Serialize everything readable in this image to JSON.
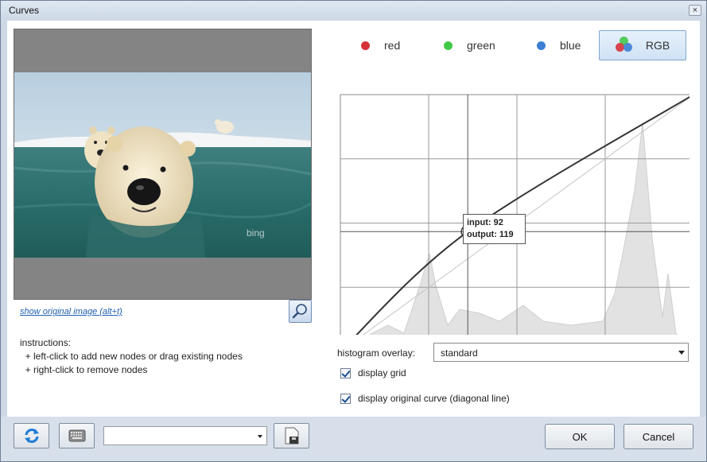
{
  "window": {
    "title": "Curves",
    "close_label": "×"
  },
  "preview": {
    "watermark": "bing"
  },
  "show_original_link": "show original image (alt+t)",
  "instructions": {
    "title": "instructions:",
    "lines": [
      "  + left-click to add new nodes or drag existing nodes",
      "  + right-click to remove nodes"
    ]
  },
  "channels": [
    {
      "label": "red",
      "color": "#d6323a"
    },
    {
      "label": "green",
      "color": "#43c94a"
    },
    {
      "label": "blue",
      "color": "#3c7fd4"
    },
    {
      "label": "RGB",
      "selected": true
    }
  ],
  "curve": {
    "nodes": [
      {
        "input": 0,
        "output": 0
      },
      {
        "input": 92,
        "output": 119
      },
      {
        "input": 255,
        "output": 255
      }
    ],
    "tooltip": {
      "input_label": "input: 92",
      "output_label": "output: 119"
    },
    "grid_divisions": 4
  },
  "histogram_overlay": {
    "label": "histogram overlay:",
    "value": "standard"
  },
  "options": {
    "display_grid": {
      "label": "display grid",
      "checked": true
    },
    "display_original": {
      "label": "display original curve (diagonal line)",
      "checked": true
    }
  },
  "footer": {
    "preset_value": "",
    "ok_label": "OK",
    "cancel_label": "Cancel"
  }
}
